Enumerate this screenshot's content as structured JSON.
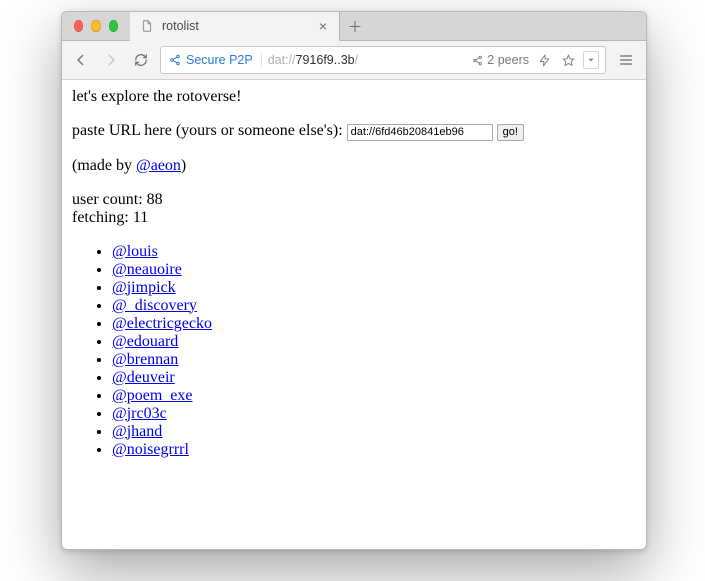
{
  "tab": {
    "title": "rotolist"
  },
  "toolbar": {
    "secure_label": "Secure P2P",
    "url_scheme": "dat",
    "url_sep": "://",
    "url_host": "7916f9..3b",
    "url_trail": "/",
    "peers_label": "2 peers"
  },
  "page": {
    "intro": "let's explore the rotoverse!",
    "paste_label": "paste URL here (yours or someone else's): ",
    "url_input_value": "dat://6fd46b20841eb96",
    "go_label": "go!",
    "made_by_prefix": "(made by ",
    "made_by_handle": "@aeon",
    "made_by_suffix": ")",
    "user_count_label": "user count: ",
    "user_count_value": "88",
    "fetching_label": "fetching: ",
    "fetching_value": "11",
    "users": [
      "@louis",
      "@neauoire",
      "@jimpick",
      "@_discovery",
      "@electricgecko",
      "@edouard",
      "@brennan",
      "@deuveir",
      "@poem_exe",
      "@jrc03c",
      "@jhand",
      "@noisegrrrl"
    ]
  }
}
